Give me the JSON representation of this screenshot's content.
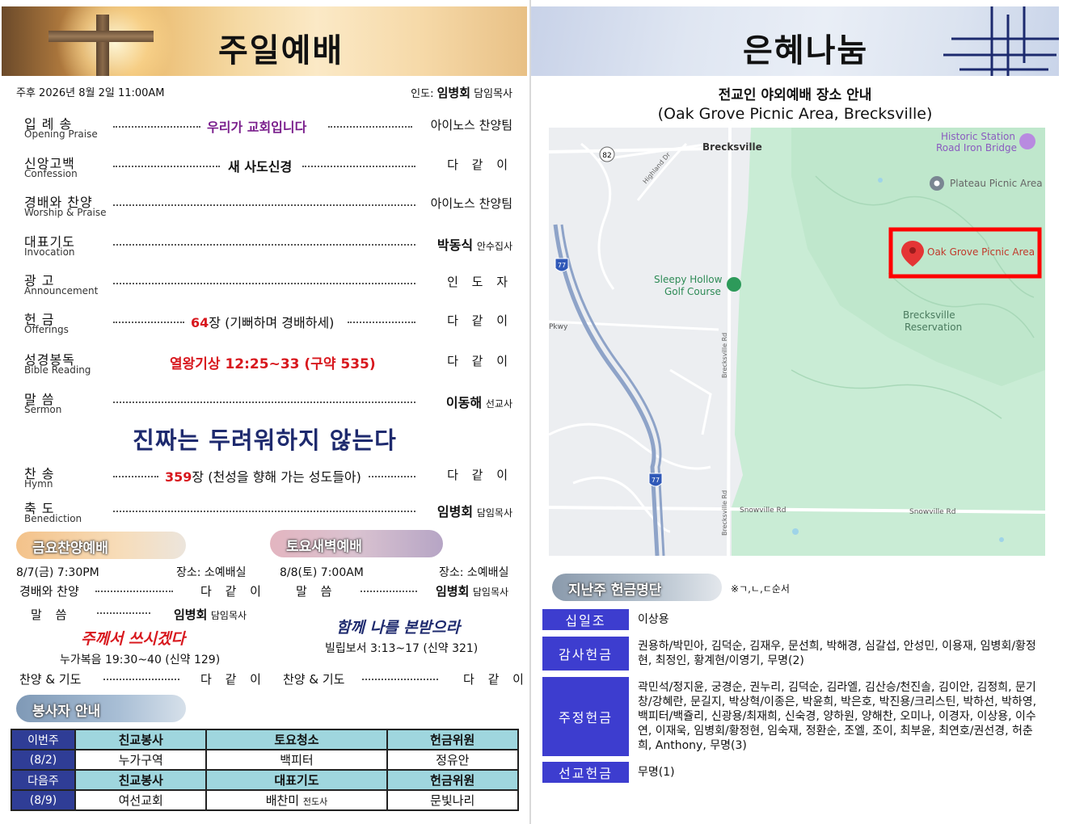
{
  "left": {
    "title": "주일예배",
    "date_line": "주후  2026년  8월  2일  11:00AM",
    "leader_label": "인도:",
    "leader_name": "임병회",
    "leader_role": "담임목사",
    "order": [
      {
        "ko": "입 례 송",
        "en": "Opening Praise",
        "mid": "우리가 교회입니다",
        "right": "아이노스 찬양팀"
      },
      {
        "ko": "신앙고백",
        "en": "Confession",
        "mid": "새 사도신경",
        "right": "다 같 이"
      },
      {
        "ko": "경배와 찬양",
        "en": "Worship & Praise",
        "mid": "",
        "right": "아이노스 찬양팀"
      },
      {
        "ko": "대표기도",
        "en": "Invocation",
        "mid": "",
        "right_name": "박동식",
        "right_role": "안수집사"
      },
      {
        "ko": "광  고",
        "en": "Announcement",
        "mid": "",
        "right": "인 도 자"
      },
      {
        "ko": "헌  금",
        "en": "Offerings",
        "mid_num": "64",
        "mid_rest": "장 (기뻐하며 경배하세)",
        "right": "다 같 이"
      },
      {
        "ko": "성경봉독",
        "en": "Bible Reading",
        "mid": "열왕기상  12:25~33  (구약 535)",
        "right": "다 같 이"
      },
      {
        "ko": "말  씀",
        "en": "Sermon",
        "mid": "",
        "right_name": "이동해",
        "right_role": "선교사"
      },
      {
        "ko": "찬  송",
        "en": "Hymn",
        "mid_num": "359",
        "mid_rest": "장 (천성을 향해 가는 성도들아)",
        "right": "다 같 이"
      },
      {
        "ko": "축  도",
        "en": "Benediction",
        "mid": "",
        "right_name": "임병회",
        "right_role": "담임목사"
      }
    ],
    "sermon_title": "진짜는 두려워하지 않는다",
    "friday": {
      "label": "금요찬양예배",
      "date": "8/7(금)  7:30PM",
      "place": "장소: 소예배실",
      "r1_left": "경배와 찬양",
      "r1_right": "다 같 이",
      "r2_left": "말  씀",
      "r2_name": "임병회",
      "r2_role": "담임목사",
      "title": "주께서 쓰시겠다",
      "verse": "누가복음  19:30~40  (신약 129)",
      "r3_left": "찬양 & 기도",
      "r3_right": "다 같 이"
    },
    "saturday": {
      "label": "토요새벽예배",
      "date": "8/8(토)  7:00AM",
      "place": "장소: 소예배실",
      "r1_left": "말  씀",
      "r1_name": "임병회",
      "r1_role": "담임목사",
      "title": "함께 나를 본받으라",
      "verse": "빌립보서  3:13~17  (신약 321)",
      "r3_left": "찬양 & 기도",
      "r3_right": "다 같 이"
    },
    "volunteer": {
      "label": "봉사자 안내",
      "this_week": "이번주",
      "this_date": "(8/2)",
      "next_week": "다음주",
      "next_date": "(8/9)",
      "this_headers": [
        "친교봉사",
        "토요청소",
        "헌금위원"
      ],
      "this_values": [
        "누가구역",
        "백피터",
        "정유안"
      ],
      "next_headers": [
        "친교봉사",
        "대표기도",
        "헌금위원"
      ],
      "next_values": [
        "여선교회",
        "배찬미",
        "문빛나리"
      ],
      "next_value_suffix": "전도사"
    }
  },
  "right": {
    "title": "은혜나눔",
    "map_title_1": "전교인 야외예배 장소 안내",
    "map_title_2": "(Oak Grove Picnic Area,  Brecksville)",
    "map": {
      "brecksville": "Brecksville",
      "historic_1": "Historic Station",
      "historic_2": "Road Iron Bridge",
      "plateau": "Plateau Picnic Area",
      "oak_grove": "Oak Grove Picnic Area",
      "sleepy_1": "Sleepy Hollow",
      "sleepy_2": "Golf Course",
      "reservation_1": "Brecksville",
      "reservation_2": "Reservation",
      "highland": "Highland Dr",
      "brecksville_rd": "Brecksville Rd",
      "snowville_1": "Snowville Rd",
      "snowville_2": "Snowville Rd",
      "pkwy": "Pkwy",
      "route_82": "82",
      "route_77a": "77",
      "route_77b": "77"
    },
    "offering": {
      "label": "지난주 헌금명단",
      "note": "※ㄱ,ㄴ,ㄷ순서",
      "rows": [
        {
          "label": "십일조",
          "value": "이상용"
        },
        {
          "label": "감사헌금",
          "value": "권용하/박민아,  김덕순,  김재우,  문선희,  박해경,  심갈섭,  안성민,  이용재,  임병회/황정현,  최정인,  황계현/이영기,  무명(2)"
        },
        {
          "label": "주정헌금",
          "value": "곽민석/정지윤,  궁경순,  권누리,  김덕순,  김라엘,  김산승/천진솔,  김이안,  김정희,  문기창/강혜란,  문길지,  박상혁/이종은,  박윤희,  박은호,  박진용/크리스틴,  박하선,  박하영,  백피터/백쥴리,  신광용/최재희,  신숙경,  양하원,  양해찬,  오미나,  이경자,  이상용,  이수연,  이재욱,  임병회/황정현,  임숙재,  정환순,  조엘,  조이,  최부윤,  최연호/권선경,  허춘희,  Anthony,  무명(3)"
        },
        {
          "label": "선교헌금",
          "value": "무명(1)"
        }
      ]
    }
  }
}
